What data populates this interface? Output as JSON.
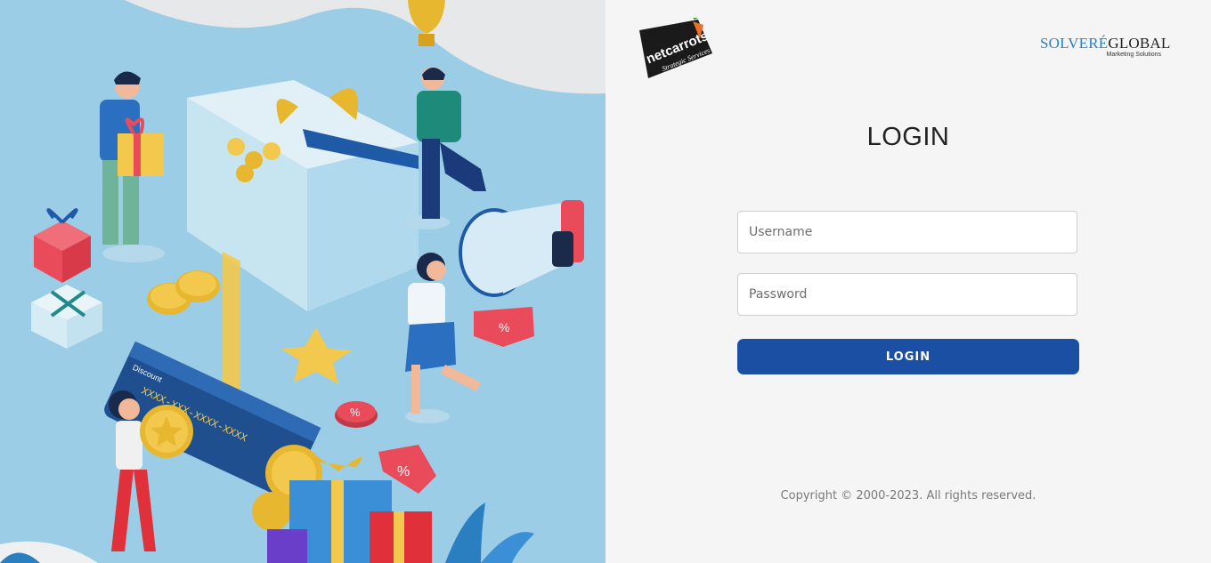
{
  "logos": {
    "left_brand": "netcarrots",
    "left_tagline": "Strategic Services",
    "right_brand_part1": "SOLVERÉ",
    "right_brand_part2": "GLOBAL",
    "right_tagline": "Marketing Solutions"
  },
  "login": {
    "title": "LOGIN",
    "username_placeholder": "Username",
    "password_placeholder": "Password",
    "submit_label": "LOGIN"
  },
  "footer": {
    "copyright": "Copyright © 2000-2023. All rights reserved."
  },
  "illustration": {
    "card_number": "XXXX-XXX-XXXX-XXXX",
    "card_label": "Discount",
    "percent_symbol": "%"
  },
  "colors": {
    "accent": "#1a4fa3",
    "illustration_background": "#9ccde6",
    "panel_background": "#f5f5f5"
  }
}
